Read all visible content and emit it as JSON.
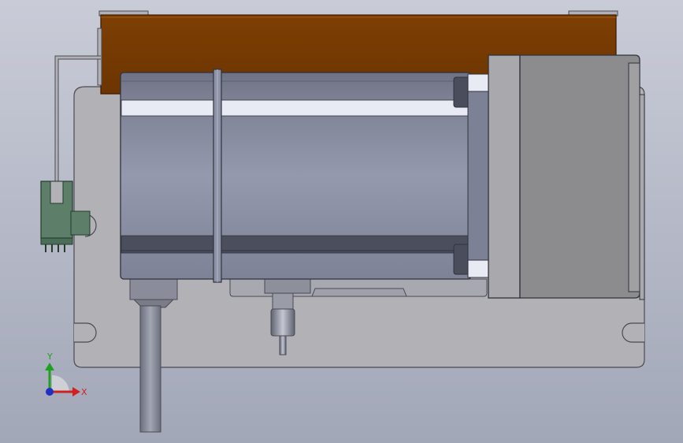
{
  "viewport": {
    "background_top": "#c9ccd7",
    "background_bottom": "#a2a7b8"
  },
  "colors": {
    "plate": "#b0b0b5",
    "plate_edge": "#4a4a55",
    "copper": "#7a3d02",
    "copper_light": "#a45a18",
    "motor_body_top": "#6f7384",
    "motor_body_mid": "#8e92a6",
    "motor_highlight": "#e8eaf4",
    "motor_dark_band": "#4a4d5c",
    "flange": "#a9a9ad",
    "gearbox": "#8c8c8e",
    "sensor_green": "#5d7f6a",
    "cable": "#8a8c99"
  },
  "triad": {
    "x_label": "X",
    "y_label": "Y",
    "x_color": "#d02020",
    "y_color": "#20a020",
    "origin_color": "#2030c0"
  }
}
